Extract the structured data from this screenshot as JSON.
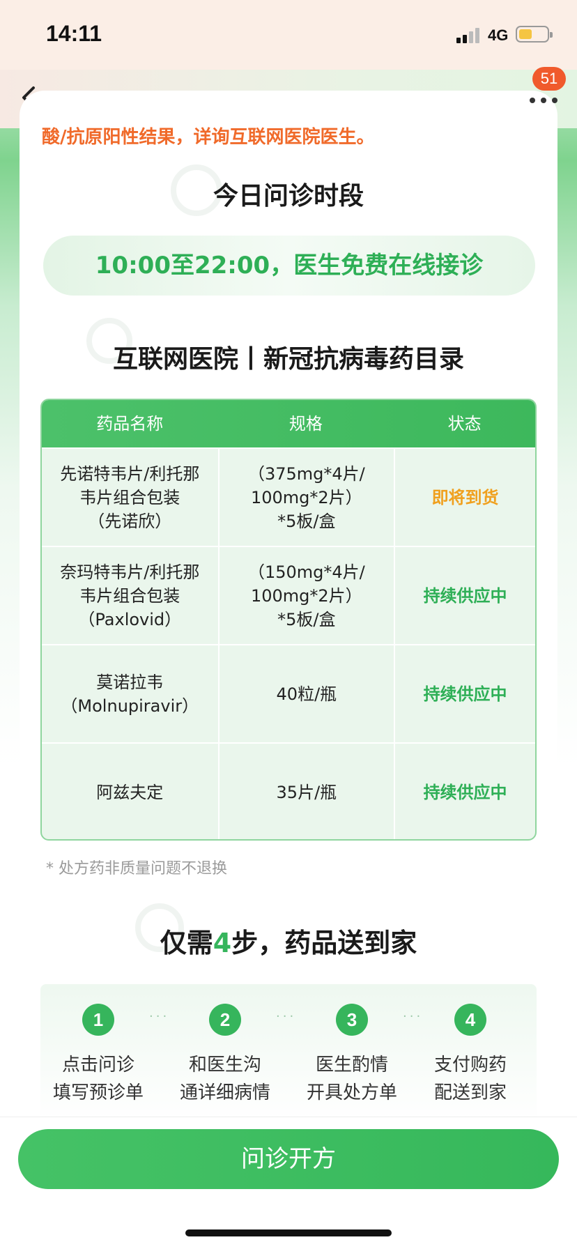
{
  "status_bar": {
    "time": "14:11",
    "network": "4G"
  },
  "nav": {
    "badge_count": "51"
  },
  "notice_text": "酸/抗原阳性结果，详询互联网医院医生。",
  "consult": {
    "title": "今日问诊时段",
    "hours_text": "10:00至22:00，医生免费在线接诊"
  },
  "catalog": {
    "title": "互联网医院丨新冠抗病毒药目录",
    "headers": [
      "药品名称",
      "规格",
      "状态"
    ],
    "rows": [
      {
        "name": "先诺特韦片/利托那\n韦片组合包装\n（先诺欣）",
        "spec": "（375mg*4片/\n100mg*2片）\n*5板/盒",
        "status": "即将到货",
        "status_type": "coming"
      },
      {
        "name": "奈玛特韦片/利托那\n韦片组合包装\n（Paxlovid）",
        "spec": "（150mg*4片/\n100mg*2片）\n*5板/盒",
        "status": "持续供应中",
        "status_type": "available"
      },
      {
        "name": "莫诺拉韦\n（Molnupiravir）",
        "spec": "40粒/瓶",
        "status": "持续供应中",
        "status_type": "available"
      },
      {
        "name": "阿兹夫定",
        "spec": "35片/瓶",
        "status": "持续供应中",
        "status_type": "available"
      }
    ],
    "footnote": "* 处方药非质量问题不退换"
  },
  "steps": {
    "title_prefix": "仅需",
    "title_num": "4",
    "title_suffix": "步，药品送到家",
    "separator": "···",
    "items": [
      {
        "num": "1",
        "label": "点击问诊\n填写预诊单"
      },
      {
        "num": "2",
        "label": "和医生沟\n通详细病情"
      },
      {
        "num": "3",
        "label": "医生酌情\n开具处方单"
      },
      {
        "num": "4",
        "label": "支付购药\n配送到家"
      }
    ]
  },
  "cta_label": "问诊开方",
  "colors": {
    "accent_green": "#36b55c",
    "warning_orange": "#f0a01e",
    "notice_orange": "#f06a2a",
    "badge_red": "#f05a2c"
  }
}
